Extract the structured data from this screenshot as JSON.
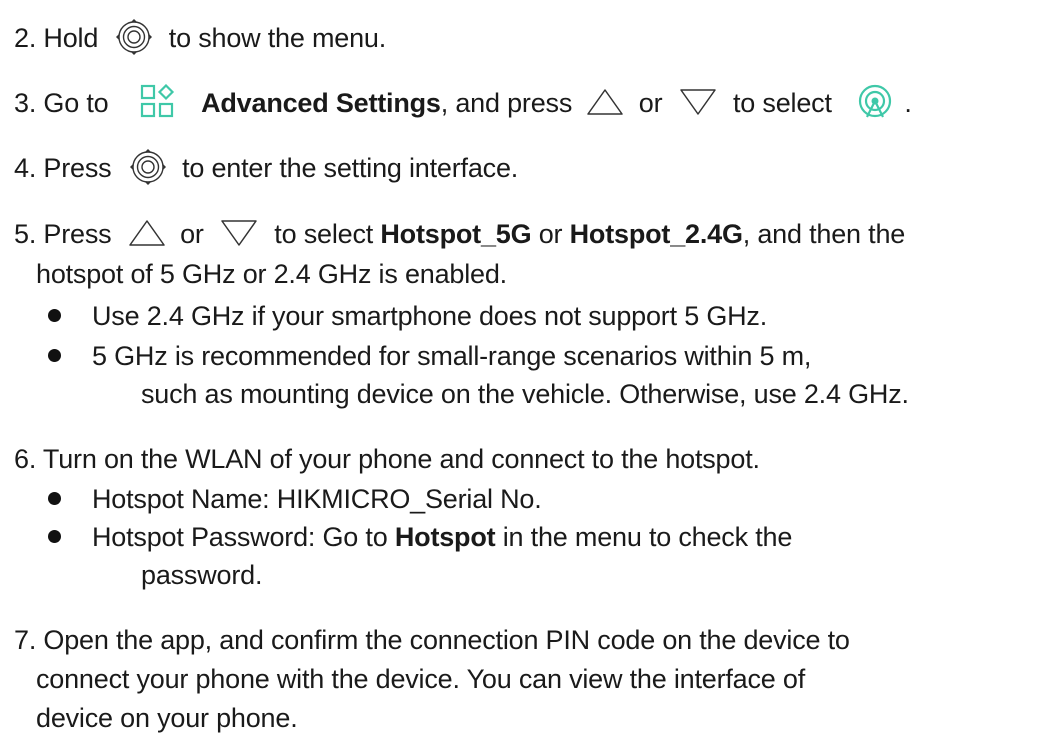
{
  "accent_color": "#3fc8a8",
  "steps": {
    "s2": {
      "num": "2. Hold",
      "icon": "dial-button-icon",
      "rest": "to show the menu."
    },
    "s3": {
      "num": "3. Go to",
      "icon1": "advanced-settings-grid-icon",
      "bold": "Advanced Settings",
      "mid": ", and press",
      "icon2": "up-triangle-icon",
      "or": "or",
      "icon3": "down-triangle-icon",
      "mid2": "to select",
      "icon4": "hotspot-broadcast-icon",
      "end": "."
    },
    "s4": {
      "num": "4. Press",
      "icon": "dial-button-icon",
      "rest": "to enter the setting interface."
    },
    "s5": {
      "num": "5. Press",
      "icon1": "up-triangle-icon",
      "or": "or",
      "icon2": "down-triangle-icon",
      "mid": "to select",
      "bold1": "Hotspot_5G",
      "or2": "or",
      "bold2": "Hotspot_2.4G",
      "end": ", and then the",
      "cont": "hotspot of 5 GHz or 2.4 GHz is enabled.",
      "bullet1": "Use 2.4 GHz if your smartphone does not support 5 GHz.",
      "bullet2_l1": "5 GHz is recommended for small-range scenarios within 5 m,",
      "bullet2_l2": "such as mounting device on the vehicle. Otherwise, use 2.4 GHz."
    },
    "s6": {
      "line": "6. Turn on the WLAN of your phone and connect to the hotspot.",
      "bullet1": "Hotspot Name: HIKMICRO_Serial No.",
      "bullet2_pre": "Hotspot Password: Go to",
      "bullet2_bold": "Hotspot",
      "bullet2_post": "in the menu to check the",
      "bullet2_l2": "password."
    },
    "s7": {
      "l1": "7. Open the app, and confirm the connection PIN code on the device to",
      "l2": "connect your phone with the device. You can view the interface of",
      "l3": "device on your phone."
    }
  }
}
